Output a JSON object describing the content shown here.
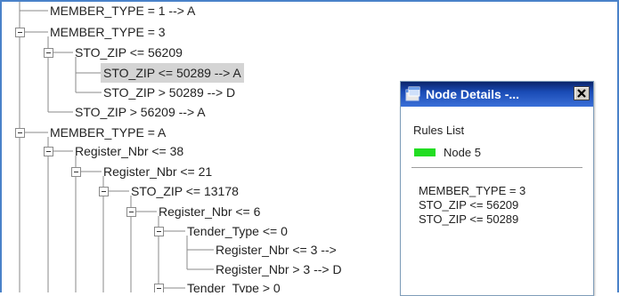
{
  "tree": {
    "nodes": [
      {
        "label": "MEMBER_TYPE = 1 --> A",
        "expandable": false,
        "selected": false
      },
      {
        "label": "MEMBER_TYPE = 3",
        "expandable": true,
        "selected": false
      },
      {
        "label": "STO_ZIP <= 56209",
        "expandable": true,
        "selected": false
      },
      {
        "label": "STO_ZIP <= 50289  --> A",
        "expandable": false,
        "selected": true
      },
      {
        "label": "STO_ZIP > 50289  --> D",
        "expandable": false,
        "selected": false
      },
      {
        "label": "STO_ZIP > 56209  --> A",
        "expandable": false,
        "selected": false
      },
      {
        "label": "MEMBER_TYPE = A",
        "expandable": true,
        "selected": false
      },
      {
        "label": "Register_Nbr <= 38",
        "expandable": true,
        "selected": false
      },
      {
        "label": "Register_Nbr <= 21",
        "expandable": true,
        "selected": false
      },
      {
        "label": "STO_ZIP <= 13178",
        "expandable": true,
        "selected": false
      },
      {
        "label": "Register_Nbr <= 6",
        "expandable": true,
        "selected": false
      },
      {
        "label": "Tender_Type <= 0",
        "expandable": true,
        "selected": false
      },
      {
        "label": "Register_Nbr <= 3  -->",
        "expandable": false,
        "selected": false
      },
      {
        "label": "Register_Nbr > 3  --> D",
        "expandable": false,
        "selected": false
      },
      {
        "label": "Tender_Type > 0",
        "expandable": true,
        "selected": false
      }
    ]
  },
  "dialog": {
    "title": "Node Details -...",
    "rules_heading": "Rules List",
    "legend_color": "#22dd22",
    "legend_label": "Node 5",
    "rules": [
      "MEMBER_TYPE = 3",
      "STO_ZIP <= 56209",
      "STO_ZIP <= 50289"
    ],
    "icon": "app-window-icon",
    "close_icon": "close-icon"
  },
  "colors": {
    "window_border": "#4a82c9",
    "titlebar": "#0a246a",
    "selection": "#d4d4d4"
  }
}
